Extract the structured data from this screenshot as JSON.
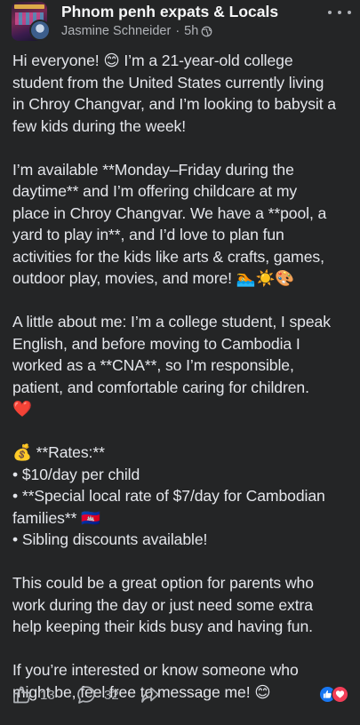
{
  "header": {
    "group_name": "Phnom penh expats & Locals",
    "author": "Jasmine Schneider",
    "separator": "·",
    "time": "5h",
    "privacy_icon": "globe-icon",
    "more_icon": "more-horizontal-icon"
  },
  "post": {
    "paragraphs": [
      [
        "Hi everyone! 😊 I’m a 21-year-old college",
        "student from the United States currently living",
        "in Chroy Changvar, and I’m looking to babysit a",
        "few kids during the week!"
      ],
      [
        "I’m available **Monday–Friday during the",
        "daytime** and I’m offering childcare at my",
        "place in Chroy Changvar. We have a **pool, a",
        "yard to play in**, and I’d love to plan fun",
        "activities for the kids like arts & crafts, games,",
        "outdoor play, movies, and more! 🏊☀️🎨"
      ],
      [
        "A little about me: I’m a college student, I speak",
        "English, and before moving to Cambodia I",
        "worked as a **CNA**, so I’m responsible,",
        "patient, and comfortable caring for children.",
        "❤️"
      ],
      [
        "💰 **Rates:**",
        "• $10/day per child",
        "• **Special local rate of $7/day for Cambodian",
        "families** 🇰🇭",
        "• Sibling discounts available!"
      ],
      [
        "This could be a great option for parents who",
        "work during the day or just need some extra",
        "help keeping their kids busy and having fun."
      ],
      [
        "If you’re interested or know someone who",
        "might be, feel free to message me! 😊"
      ]
    ]
  },
  "footer": {
    "likes_count": "13",
    "comments_count": "32",
    "like_icon": "thumbs-up-icon",
    "comment_icon": "comment-bubble-icon",
    "share_icon": "share-arrow-icon",
    "reactions": [
      "like-reaction-icon",
      "love-reaction-icon"
    ],
    "colors": {
      "like": "#1877f2",
      "love": "#f33e58"
    }
  }
}
